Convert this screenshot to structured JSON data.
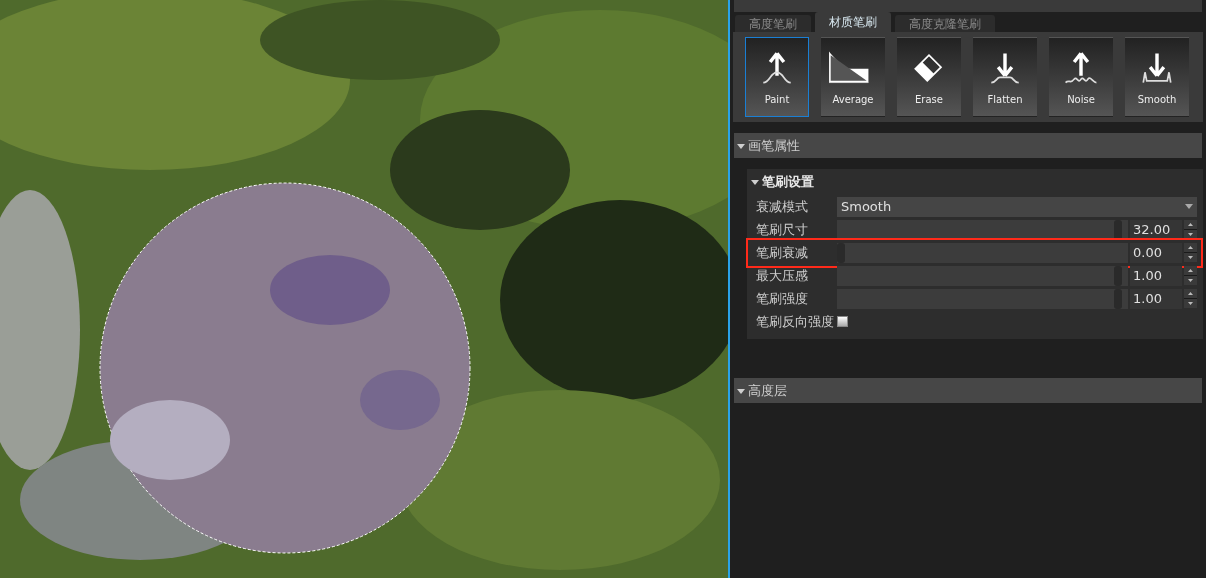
{
  "brush_type": {
    "tabs": [
      {
        "label": "高度笔刷",
        "selected": false
      },
      {
        "label": "材质笔刷",
        "selected": true
      },
      {
        "label": "高度克隆笔刷",
        "selected": false
      }
    ],
    "brushes": [
      {
        "label": "Paint",
        "kind": "paint",
        "selected": true
      },
      {
        "label": "Average",
        "kind": "average",
        "selected": false
      },
      {
        "label": "Erase",
        "kind": "erase",
        "selected": false
      },
      {
        "label": "Flatten",
        "kind": "flatten",
        "selected": false
      },
      {
        "label": "Noise",
        "kind": "noise",
        "selected": false
      },
      {
        "label": "Smooth",
        "kind": "smooth",
        "selected": false
      }
    ]
  },
  "brush_properties": {
    "title": "画笔属性",
    "expanded": true,
    "group": {
      "title": "笔刷设置",
      "expanded": true,
      "rows": [
        {
          "kind": "dropdown",
          "label": "衰减模式",
          "value": "Smooth"
        },
        {
          "kind": "slider",
          "label": "笔刷尺寸",
          "level": 0.98,
          "value": "32.00",
          "highlighted": false
        },
        {
          "kind": "slider",
          "label": "笔刷衰减",
          "level": 0,
          "value": "0.00",
          "highlighted": true
        },
        {
          "kind": "slider",
          "label": "最大压感",
          "level": 0.98,
          "value": "1.00",
          "highlighted": false
        },
        {
          "kind": "slider",
          "label": "笔刷强度",
          "level": 0.98,
          "value": "1.00",
          "highlighted": false
        },
        {
          "kind": "checkbox",
          "label": "笔刷反向强度",
          "checked": false
        }
      ]
    }
  },
  "height_layers": {
    "title": "高度层",
    "expanded": true
  }
}
